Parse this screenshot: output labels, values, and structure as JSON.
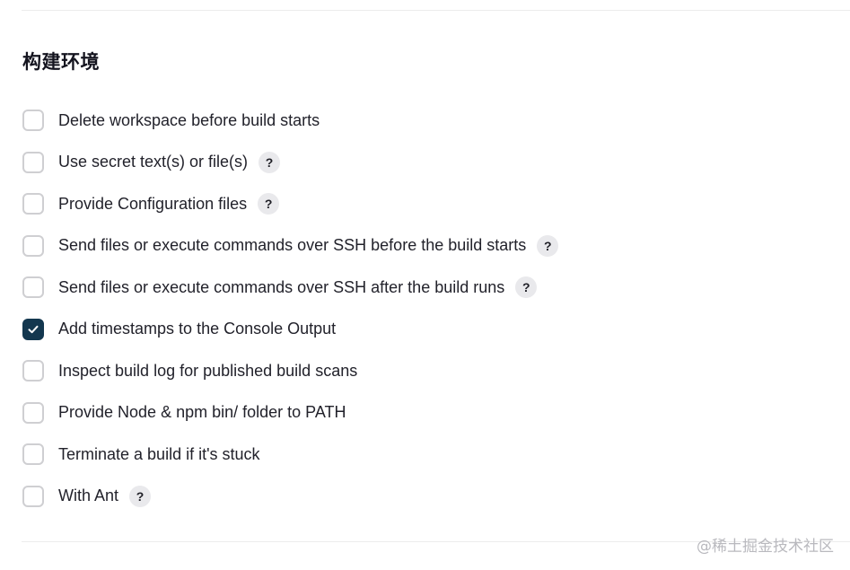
{
  "section": {
    "title": "构建环境"
  },
  "options": [
    {
      "label": "Delete workspace before build starts",
      "checked": false,
      "help": false
    },
    {
      "label": "Use secret text(s) or file(s)",
      "checked": false,
      "help": true
    },
    {
      "label": "Provide Configuration files",
      "checked": false,
      "help": true
    },
    {
      "label": "Send files or execute commands over SSH before the build starts",
      "checked": false,
      "help": true
    },
    {
      "label": "Send files or execute commands over SSH after the build runs",
      "checked": false,
      "help": true
    },
    {
      "label": "Add timestamps to the Console Output",
      "checked": true,
      "help": false
    },
    {
      "label": "Inspect build log for published build scans",
      "checked": false,
      "help": false
    },
    {
      "label": "Provide Node & npm bin/ folder to PATH",
      "checked": false,
      "help": false
    },
    {
      "label": "Terminate a build if it's stuck",
      "checked": false,
      "help": false
    },
    {
      "label": "With Ant",
      "checked": false,
      "help": true
    }
  ],
  "help_glyph": "?",
  "icons": {
    "check": "checkmark-icon",
    "help": "question-mark-icon"
  },
  "colors": {
    "checked_fill": "#13374f",
    "checkbox_border": "#cfcfd2",
    "help_bg": "#e9e9ec"
  },
  "watermark": "@稀土掘金技术社区"
}
